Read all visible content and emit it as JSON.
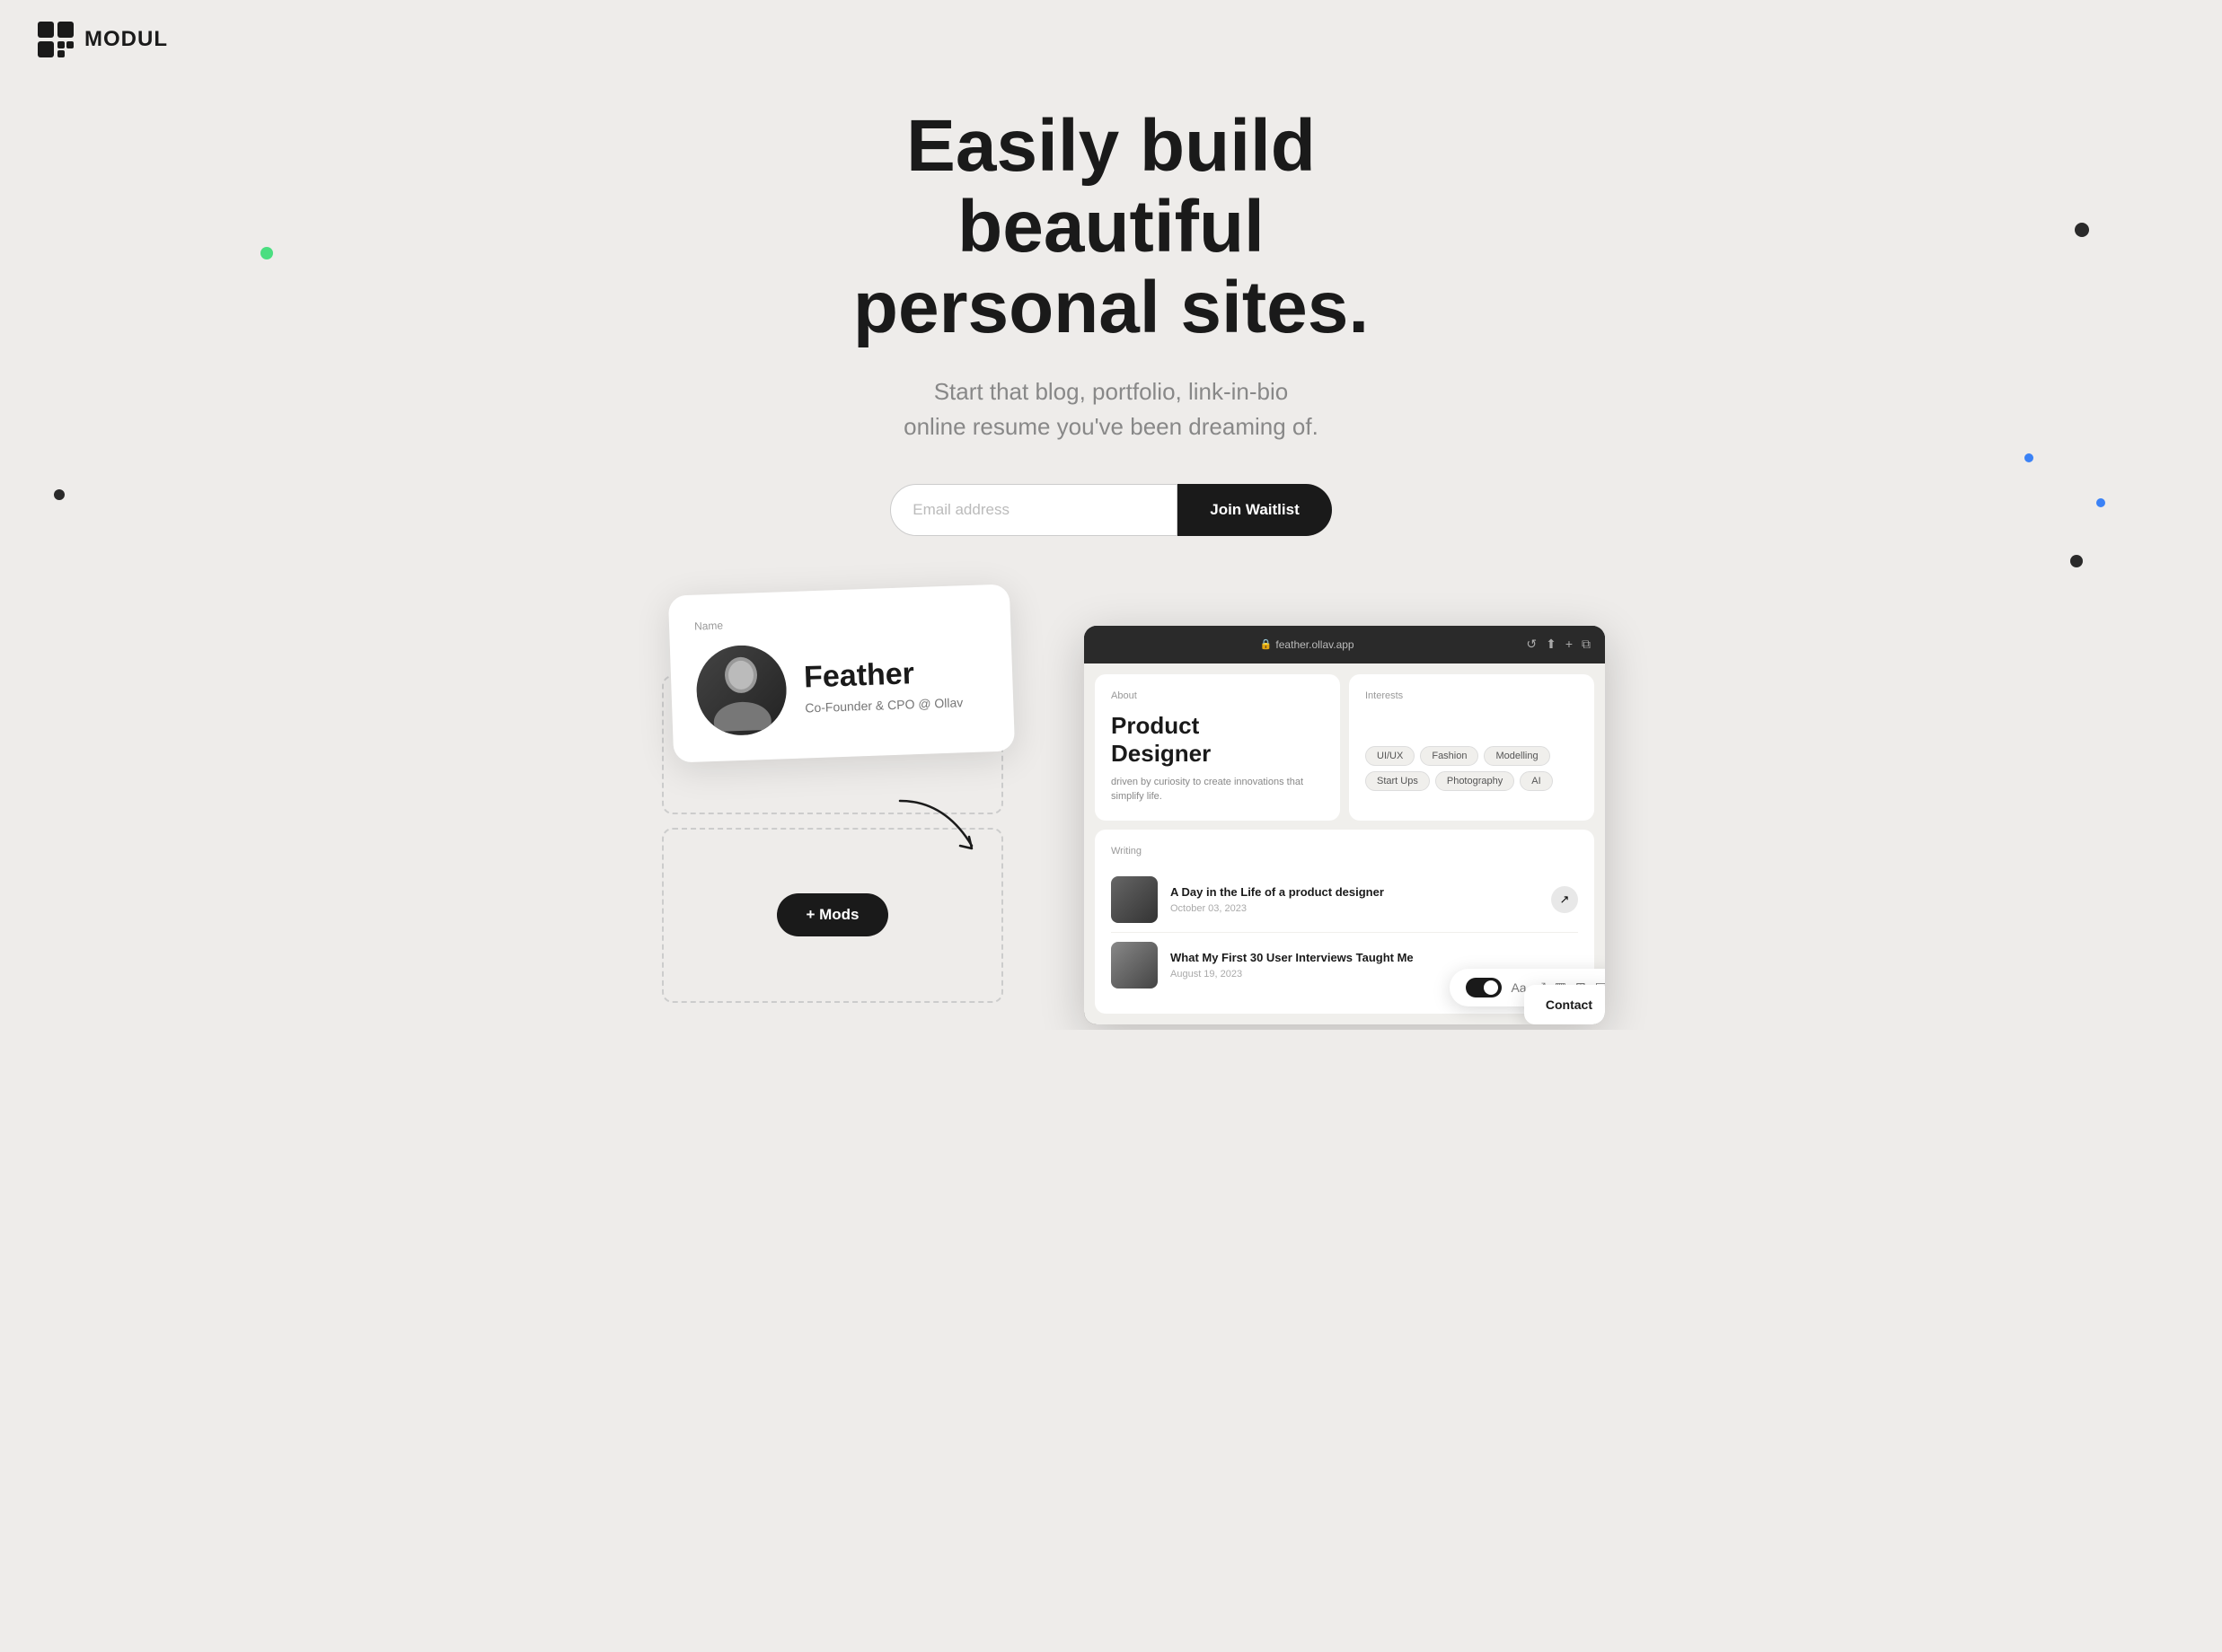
{
  "logo": {
    "name": "MODUL"
  },
  "hero": {
    "title_line1": "Easily build beautiful",
    "title_line2": "personal sites.",
    "subtitle_line1": "Start that blog, portfolio, link-in-bio",
    "subtitle_line2": "online resume you've been dreaming of.",
    "email_placeholder": "Email address",
    "cta_button": "Join Waitlist"
  },
  "profile_card": {
    "label": "Name",
    "name": "Feather",
    "role": "Co-Founder & CPO @ Ollav"
  },
  "mods_button": "+ Mods",
  "browser": {
    "url": "feather.ollav.app",
    "about_label": "About",
    "job_title_line1": "Product",
    "job_title_line2": "Designer",
    "job_desc": "driven by curiosity to create innovations that simplify life.",
    "interests_label": "Interests",
    "tags": [
      "UI/UX",
      "Fashion",
      "Modelling",
      "Start Ups",
      "Photography",
      "AI"
    ],
    "writing_label": "Writing",
    "articles": [
      {
        "title": "A Day in the Life of a product designer",
        "date": "October 03, 2023"
      },
      {
        "title": "What My First 30 User Interviews Taught Me",
        "date": "August 19, 2023"
      }
    ]
  },
  "toolbar": {
    "label": "Aa"
  },
  "contact_card": {
    "label": "Contact"
  }
}
